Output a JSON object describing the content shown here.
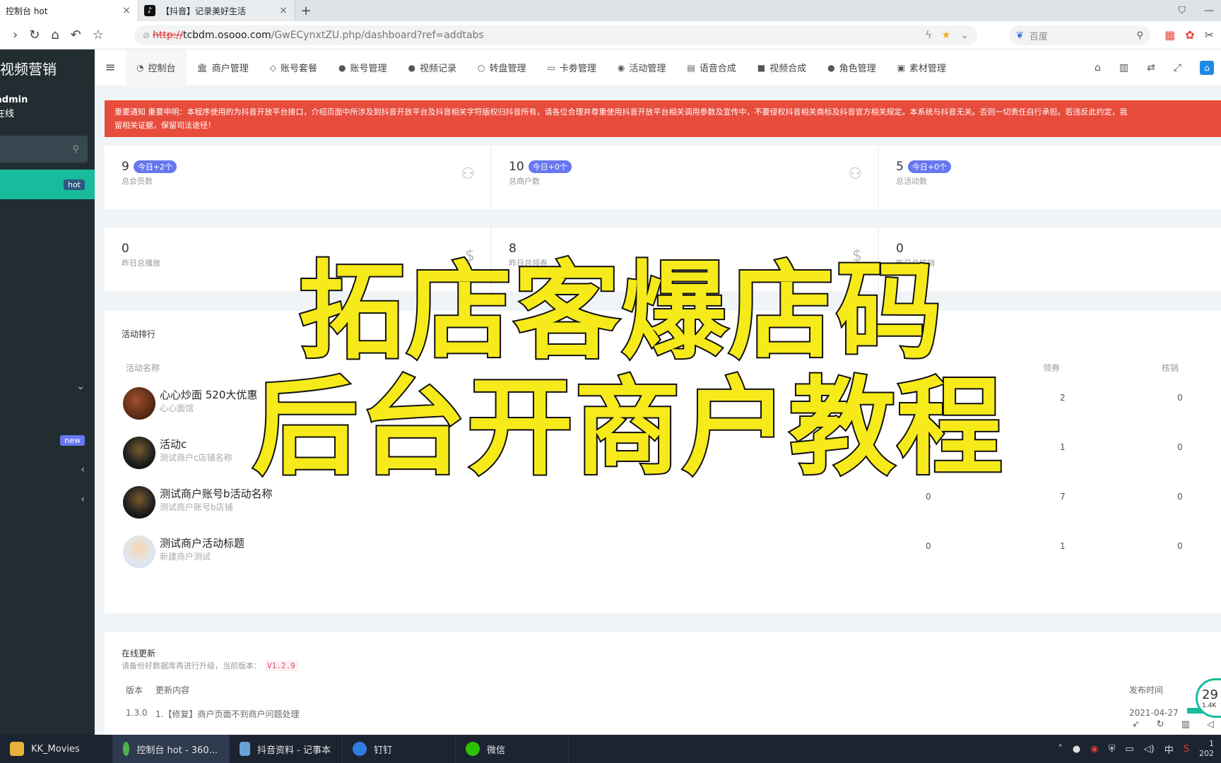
{
  "browser": {
    "tabs": [
      {
        "title": "控制台 hot",
        "close": "×"
      },
      {
        "title": "【抖音】记录美好生活",
        "close": "×"
      }
    ],
    "new_tab": "+",
    "url": {
      "scheme": "http://",
      "host": "tcbdm.osooo.com",
      "path": "/GwECynxtZU.php/dashboard?ref=addtabs"
    },
    "search_placeholder": "百度"
  },
  "sidebar": {
    "brand": "短视频营销",
    "user_name": "admin",
    "user_status": "在线",
    "badges": {
      "hot": "hot",
      "new": "new"
    }
  },
  "topmenu": {
    "items": [
      {
        "icon": "dashboard-icon",
        "glyph": "◔",
        "label": "控制台"
      },
      {
        "icon": "bank-icon",
        "glyph": "🏛",
        "label": "商户管理"
      },
      {
        "icon": "diamond-icon",
        "glyph": "◇",
        "label": "账号套餐"
      },
      {
        "icon": "user-icon",
        "glyph": "●",
        "label": "账号管理"
      },
      {
        "icon": "users-icon",
        "glyph": "●",
        "label": "视频记录"
      },
      {
        "icon": "circle-icon",
        "glyph": "○",
        "label": "转盘管理"
      },
      {
        "icon": "card-icon",
        "glyph": "▭",
        "label": "卡劵管理"
      },
      {
        "icon": "dot-circle-icon",
        "glyph": "◉",
        "label": "活动管理"
      },
      {
        "icon": "file-icon",
        "glyph": "▤",
        "label": "语音合成"
      },
      {
        "icon": "video-icon",
        "glyph": "■",
        "label": "视频合成"
      },
      {
        "icon": "users-icon",
        "glyph": "●",
        "label": "角色管理"
      },
      {
        "icon": "image-icon",
        "glyph": "▣",
        "label": "素材管理"
      }
    ]
  },
  "alert": {
    "text": "重要通知 重要申明：本程序使用的为抖音开放平台接口，介绍页面中所涉及到抖音开放平台及抖音相关字符版权归抖音所有，请各位合理并尊重使用抖音开放平台相关调用参数及宣传中，不要侵权抖音相关商标及抖音官方相关规定。本系统与抖音无关。否则一切责任自行承担。若违反此约定，我",
    "text2": "留相关证据，保留司法途径！"
  },
  "stats_row1": [
    {
      "value": "9",
      "tag": "今日+2个",
      "label": "总会员数"
    },
    {
      "value": "10",
      "tag": "今日+0个",
      "label": "总商户数"
    },
    {
      "value": "5",
      "tag": "今日+0个",
      "label": "总活动数"
    }
  ],
  "stats_row2": [
    {
      "value": "0",
      "label": "昨日总播放"
    },
    {
      "value": "8",
      "label": "昨日总领券"
    },
    {
      "value": "0",
      "label": "昨日总核销"
    }
  ],
  "ranking": {
    "title": "活动排行",
    "headers": {
      "name": "活动名称",
      "col_a": "领券",
      "col_b": "核销"
    },
    "rows": [
      {
        "name": "心心炒面 520大优惠",
        "sub": "心心面馆",
        "v1": "",
        "v2": "2",
        "v3": "0"
      },
      {
        "name": "活动c",
        "sub": "测试商户c店铺名称",
        "v1": "0",
        "v2": "1",
        "v3": "0"
      },
      {
        "name": "测试商户账号b活动名称",
        "sub": "测试商户账号b店铺",
        "v1": "0",
        "v2": "7",
        "v3": "0"
      },
      {
        "name": "测试商户活动标题",
        "sub": "新建商户测试",
        "v1": "0",
        "v2": "1",
        "v3": "0"
      }
    ]
  },
  "update": {
    "title": "在线更新",
    "subtitle": "请备份好数据库再进行升级，当前版本：",
    "version": "V1.2.9",
    "headers": {
      "version": "版本",
      "content": "更新内容",
      "date": "发布时间"
    },
    "row": {
      "version": "1.3.0",
      "content": "1.【修复】商户页面不到商户问题处理",
      "date": "2021-04-27"
    }
  },
  "overlay": {
    "line1": "拓店客爆店码",
    "line2": "后台开商户教程"
  },
  "speed": {
    "value": "29",
    "unit": "1.4K"
  },
  "taskbar": {
    "items": [
      {
        "label": "KK_Movies",
        "color": "#e8b23a"
      },
      {
        "label": "控制台 hot - 360...",
        "color": "#4caf50"
      },
      {
        "label": "抖音资料 - 记事本",
        "color": "#6aa0d8"
      },
      {
        "label": "钉钉",
        "color": "#2f7de1"
      },
      {
        "label": "微信",
        "color": "#2dc100"
      }
    ],
    "ime": "中",
    "clock_top": "1",
    "clock_bottom": "202"
  }
}
